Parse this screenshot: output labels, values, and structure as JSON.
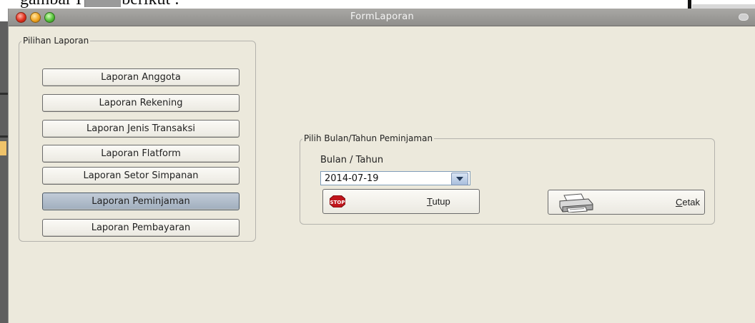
{
  "background": {
    "document_text": "gambar IV.18. berikut :"
  },
  "window": {
    "title": "FormLaporan"
  },
  "report_group": {
    "legend": "Pilihan Laporan",
    "buttons": [
      {
        "label": "Laporan Anggota",
        "selected": false
      },
      {
        "label": "Laporan Rekening",
        "selected": false
      },
      {
        "label": "Laporan Jenis Transaksi",
        "selected": false
      },
      {
        "label": "Laporan Flatform",
        "selected": false
      },
      {
        "label": "Laporan Setor Simpanan",
        "selected": false
      },
      {
        "label": "Laporan Peminjaman",
        "selected": true
      },
      {
        "label": "Laporan Pembayaran",
        "selected": false
      }
    ]
  },
  "period_group": {
    "legend": "Pilih Bulan/Tahun Peminjaman",
    "field_label": "Bulan / Tahun",
    "date_value": "2014-07-19"
  },
  "actions": {
    "close": {
      "mnemonic": "T",
      "rest": "utup",
      "icon": "stop-icon",
      "icon_text": "STOP"
    },
    "print": {
      "mnemonic": "C",
      "rest": "etak",
      "icon": "printer-icon"
    }
  },
  "colors": {
    "window_bg": "#ece9dc",
    "titlebar": "#9d9c99",
    "selected_button": "#aab6c4",
    "stop_red": "#c0161c"
  }
}
